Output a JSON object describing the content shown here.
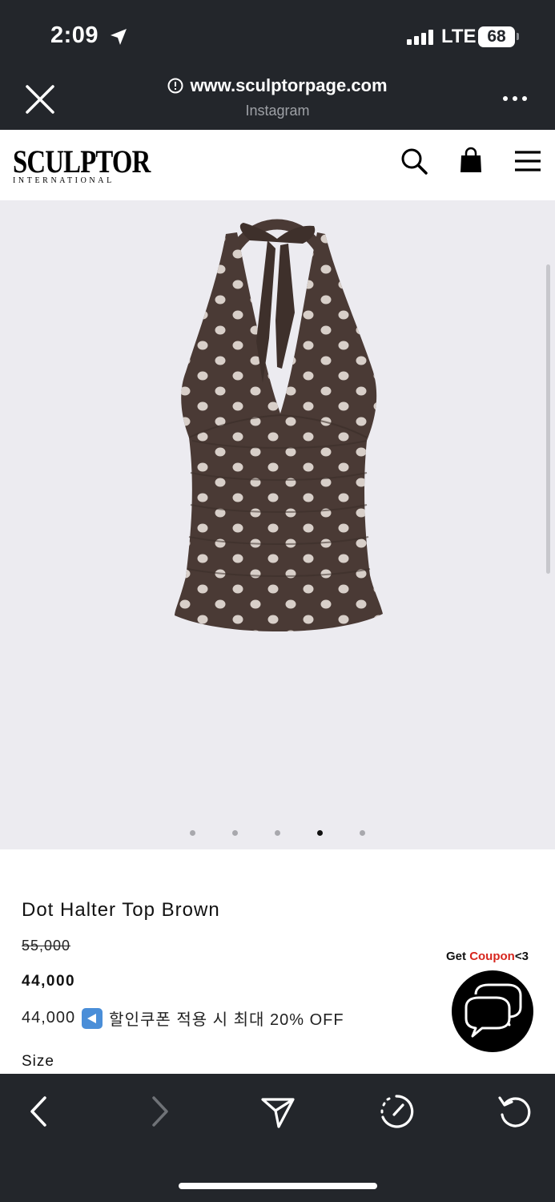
{
  "status_bar": {
    "time": "2:09",
    "network": "LTE",
    "battery": "68"
  },
  "browser": {
    "url": "www.sculptorpage.com",
    "source": "Instagram"
  },
  "site": {
    "logo_main": "SCULPTOR",
    "logo_sub": "INTERNATIONAL"
  },
  "gallery": {
    "slide_count": 5,
    "active_index": 3
  },
  "product": {
    "title": "Dot Halter Top Brown",
    "original_price": "55,000",
    "price": "44,000",
    "promo_price": "44,000",
    "promo_text": "할인쿠폰 적용 시 최대 20% OFF",
    "size_label": "Size"
  },
  "coupon": {
    "get": "Get ",
    "coupon": "Coupon",
    "suffix": "<3"
  },
  "colors": {
    "chrome": "#23262b",
    "gallery_bg": "#ecebf0",
    "garment": "#4a3a35",
    "coupon_red": "#d7261e"
  }
}
